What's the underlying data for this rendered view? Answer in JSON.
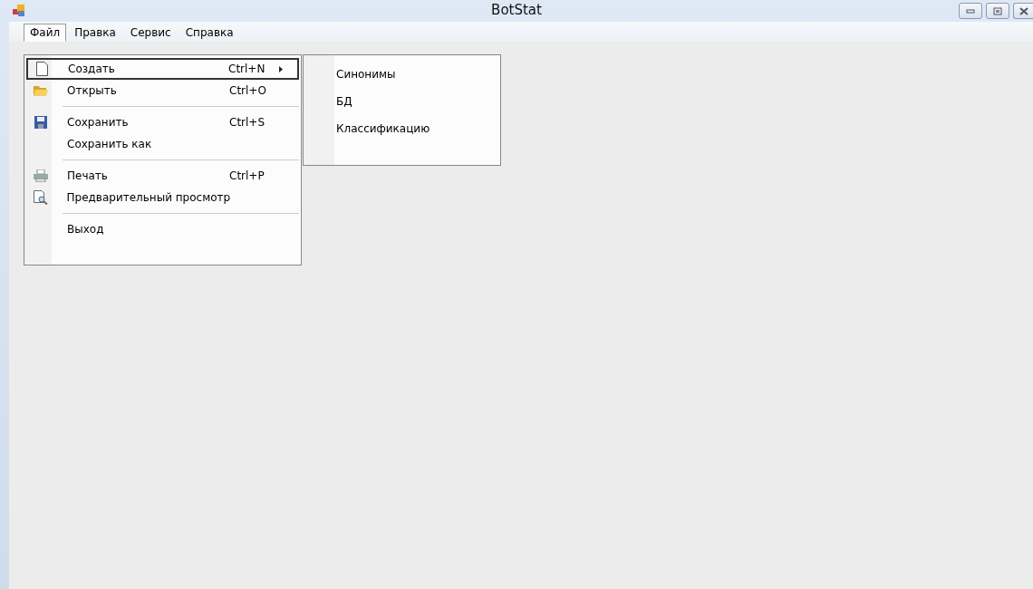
{
  "window": {
    "title": "BotStat"
  },
  "menu_bar": [
    {
      "label": "Файл",
      "selected": true
    },
    {
      "label": "Правка",
      "selected": false
    },
    {
      "label": "Сервис",
      "selected": false
    },
    {
      "label": "Справка",
      "selected": false
    }
  ],
  "file_menu": [
    {
      "kind": "item",
      "label": "Создать",
      "shortcut": "Ctrl+N",
      "submenu": true,
      "selected": true
    },
    {
      "kind": "item",
      "label": "Открыть",
      "shortcut": "Ctrl+O",
      "submenu": false,
      "selected": false
    },
    {
      "kind": "separator"
    },
    {
      "kind": "item",
      "label": "Сохранить",
      "shortcut": "Ctrl+S",
      "submenu": false,
      "selected": false
    },
    {
      "kind": "item",
      "label": "Сохранить как",
      "submenu": false,
      "selected": false
    },
    {
      "kind": "separator"
    },
    {
      "kind": "item",
      "label": "Печать",
      "shortcut": "Ctrl+P",
      "submenu": false,
      "selected": false
    },
    {
      "kind": "item",
      "label": "Предварительный просмотр",
      "submenu": false,
      "selected": false
    },
    {
      "kind": "separator"
    },
    {
      "kind": "item",
      "label": "Выход",
      "submenu": false,
      "selected": false
    }
  ],
  "submenu": [
    {
      "label": "Синонимы"
    },
    {
      "label": "БД"
    },
    {
      "label": "Классификацию"
    }
  ]
}
